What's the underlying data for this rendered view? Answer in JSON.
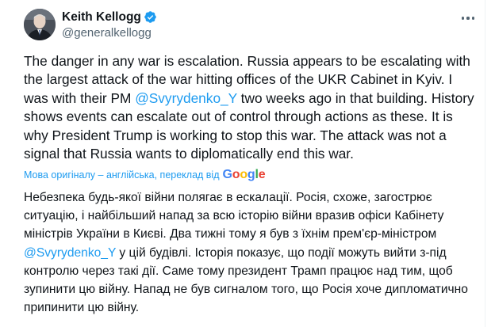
{
  "author": {
    "display_name": "Keith Kellogg",
    "handle": "@generalkellogg",
    "verified_icon": "verified-badge-icon",
    "accent_color": "#1d9bf0"
  },
  "tweet": {
    "text_before_mention": "The danger in any war is escalation. Russia appears to be escalating with the largest attack of the war hitting offices of the UKR Cabinet in Kyiv. I was with their PM ",
    "mention": "@Svyrydenko_Y",
    "text_after_mention": " two weeks ago in that building. History shows events can escalate out of control through actions as these. It is why President Trump is working to stop this war. The attack was not a signal that Russia wants to diplomatically end this war."
  },
  "translation": {
    "label": "Мова оригіналу – англійська, переклад від",
    "provider": "Google",
    "text_before_mention": "Небезпека будь-якої війни полягає в ескалації. Росія, схоже, загострює ситуацію, і найбільший напад за всю історію війни вразив офіси Кабінету міністрів України в Києві. Два тижні тому я був з їхнім прем'єр-міністром ",
    "mention": "@Svyrydenko_Y",
    "text_after_mention": " у цій будівлі. Історія показує, що події можуть вийти з-під контролю через такі дії. Саме тому президент Трамп працює над тим, щоб зупинити цю війну. Напад не був сигналом того, що Росія хоче дипломатично припинити цю війну."
  }
}
